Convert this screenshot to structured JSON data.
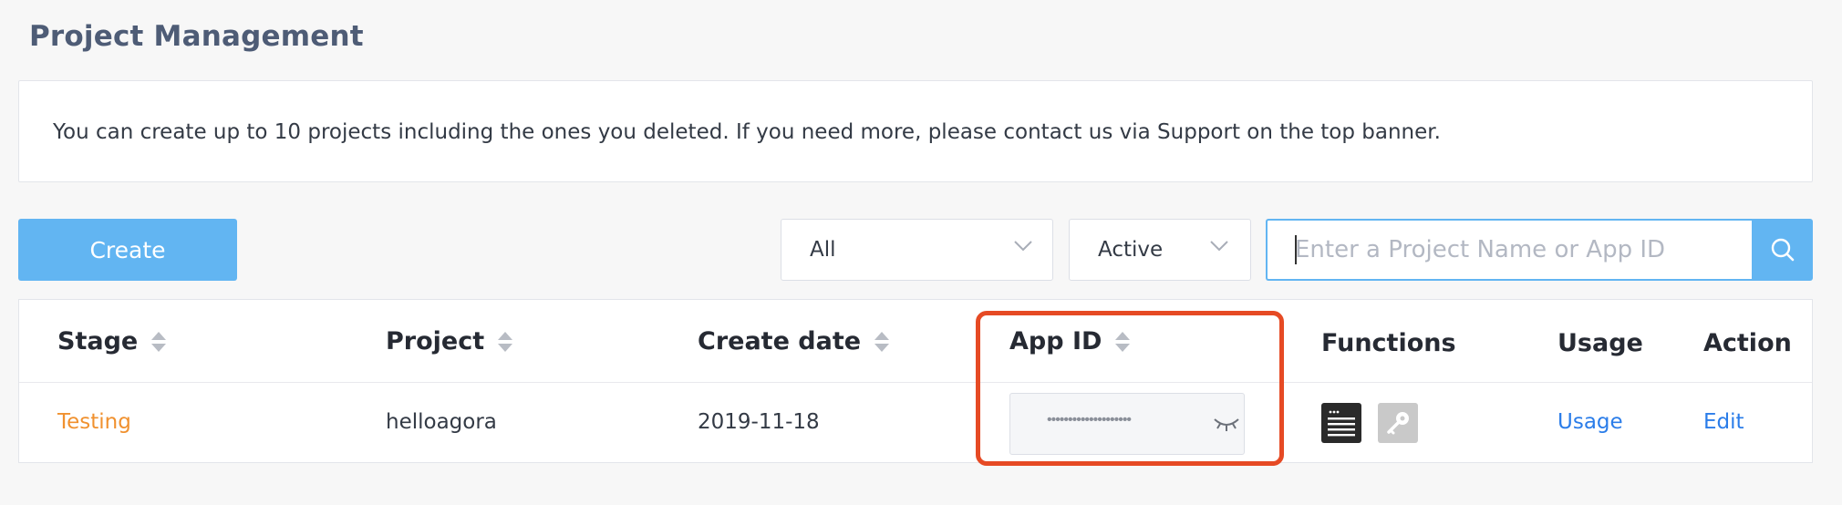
{
  "page": {
    "title": "Project Management",
    "notice": "You can create up to 10 projects including the ones you deleted. If you need more, please contact us via Support on the top banner."
  },
  "toolbar": {
    "create_label": "Create",
    "filter_all": "All",
    "filter_status": "Active",
    "search_placeholder": "Enter a Project Name or App ID"
  },
  "table": {
    "headers": {
      "stage": "Stage",
      "project": "Project",
      "create_date": "Create date",
      "app_id": "App ID",
      "functions": "Functions",
      "usage": "Usage",
      "action": "Action"
    },
    "rows": [
      {
        "stage": "Testing",
        "project": "helloagora",
        "create_date": "2019-11-18",
        "app_id_masked": "••••••••••••••••••••",
        "usage_link": "Usage",
        "action_link": "Edit"
      }
    ]
  },
  "colors": {
    "accent": "#62b5f2",
    "stage_testing": "#f0912f",
    "link": "#2b7de9",
    "highlight": "#e64a24"
  },
  "icons": {
    "sort": "sort-icon",
    "chevron": "chevron-down-icon",
    "search": "search-icon",
    "eye": "eye-closed-icon",
    "menu": "menu-list-icon",
    "key": "key-icon"
  }
}
